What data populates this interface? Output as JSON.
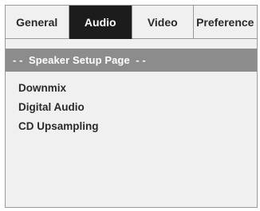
{
  "tabs": [
    {
      "label": "General",
      "active": false
    },
    {
      "label": "Audio",
      "active": true
    },
    {
      "label": "Video",
      "active": false
    },
    {
      "label": "Preference",
      "active": false
    }
  ],
  "page_header": {
    "title": "- -  Speaker Setup Page  - -"
  },
  "menu": {
    "items": [
      {
        "label": "Downmix"
      },
      {
        "label": "Digital Audio"
      },
      {
        "label": "CD Upsampling"
      }
    ]
  },
  "colors": {
    "active_tab_bg": "#1c1c1c",
    "header_bar_bg": "#8c8c8c",
    "panel_bg": "#f1f0f0"
  }
}
